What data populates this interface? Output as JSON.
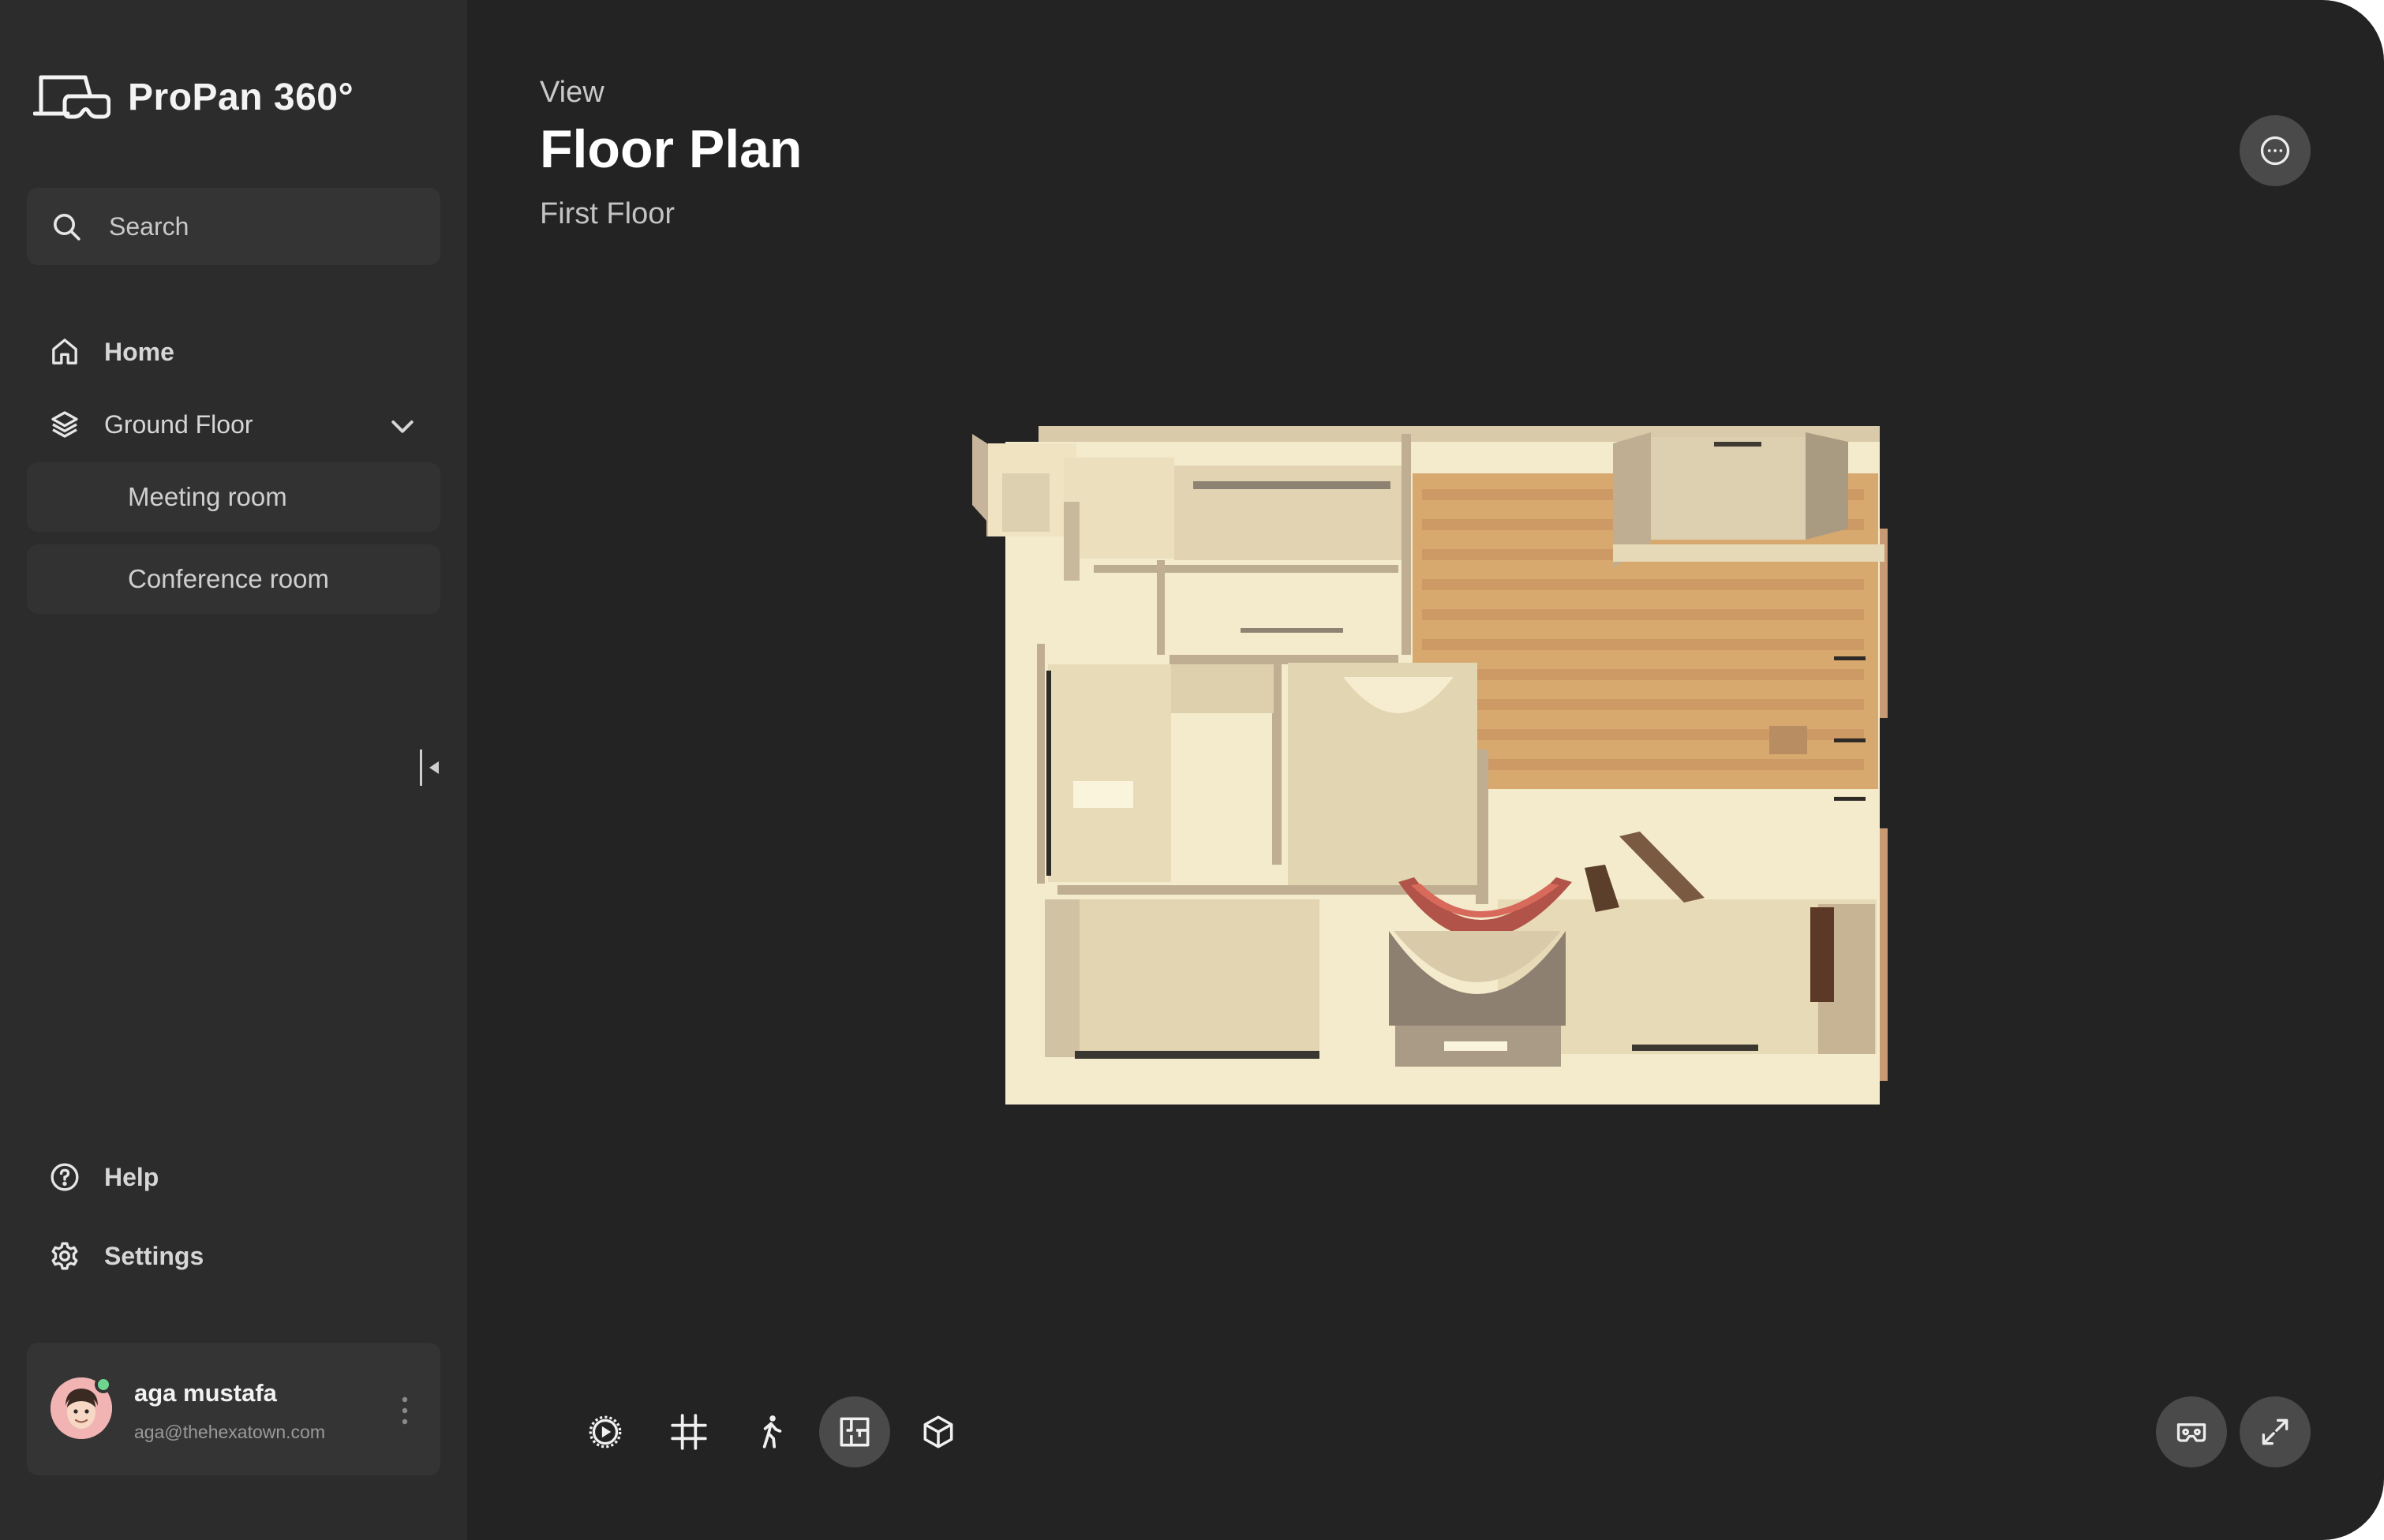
{
  "app": {
    "name": "ProPan 360°"
  },
  "search": {
    "placeholder": "Search"
  },
  "nav": {
    "home": "Home",
    "floor": {
      "label": "Ground Floor",
      "expanded": true
    },
    "rooms": [
      "Meeting room",
      "Conference room"
    ],
    "help": "Help",
    "settings": "Settings"
  },
  "user": {
    "name": "aga mustafa",
    "email": "aga@thehexatown.com",
    "online": true
  },
  "header": {
    "eyebrow": "View",
    "title": "Floor Plan",
    "subtitle": "First Floor"
  },
  "toolbar": {
    "modes": [
      "autoplay-icon",
      "crop-icon",
      "walk-icon",
      "floor-plan-icon",
      "dollhouse-icon"
    ],
    "active": "floor-plan-icon"
  },
  "actions": [
    "more-options-icon",
    "vr-headset-icon",
    "fullscreen-icon"
  ],
  "colors": {
    "background": "#232323",
    "sidebar": "#2c2c2c",
    "card": "#343434",
    "button": "#4a4a4a",
    "online": "#6ed58f"
  }
}
